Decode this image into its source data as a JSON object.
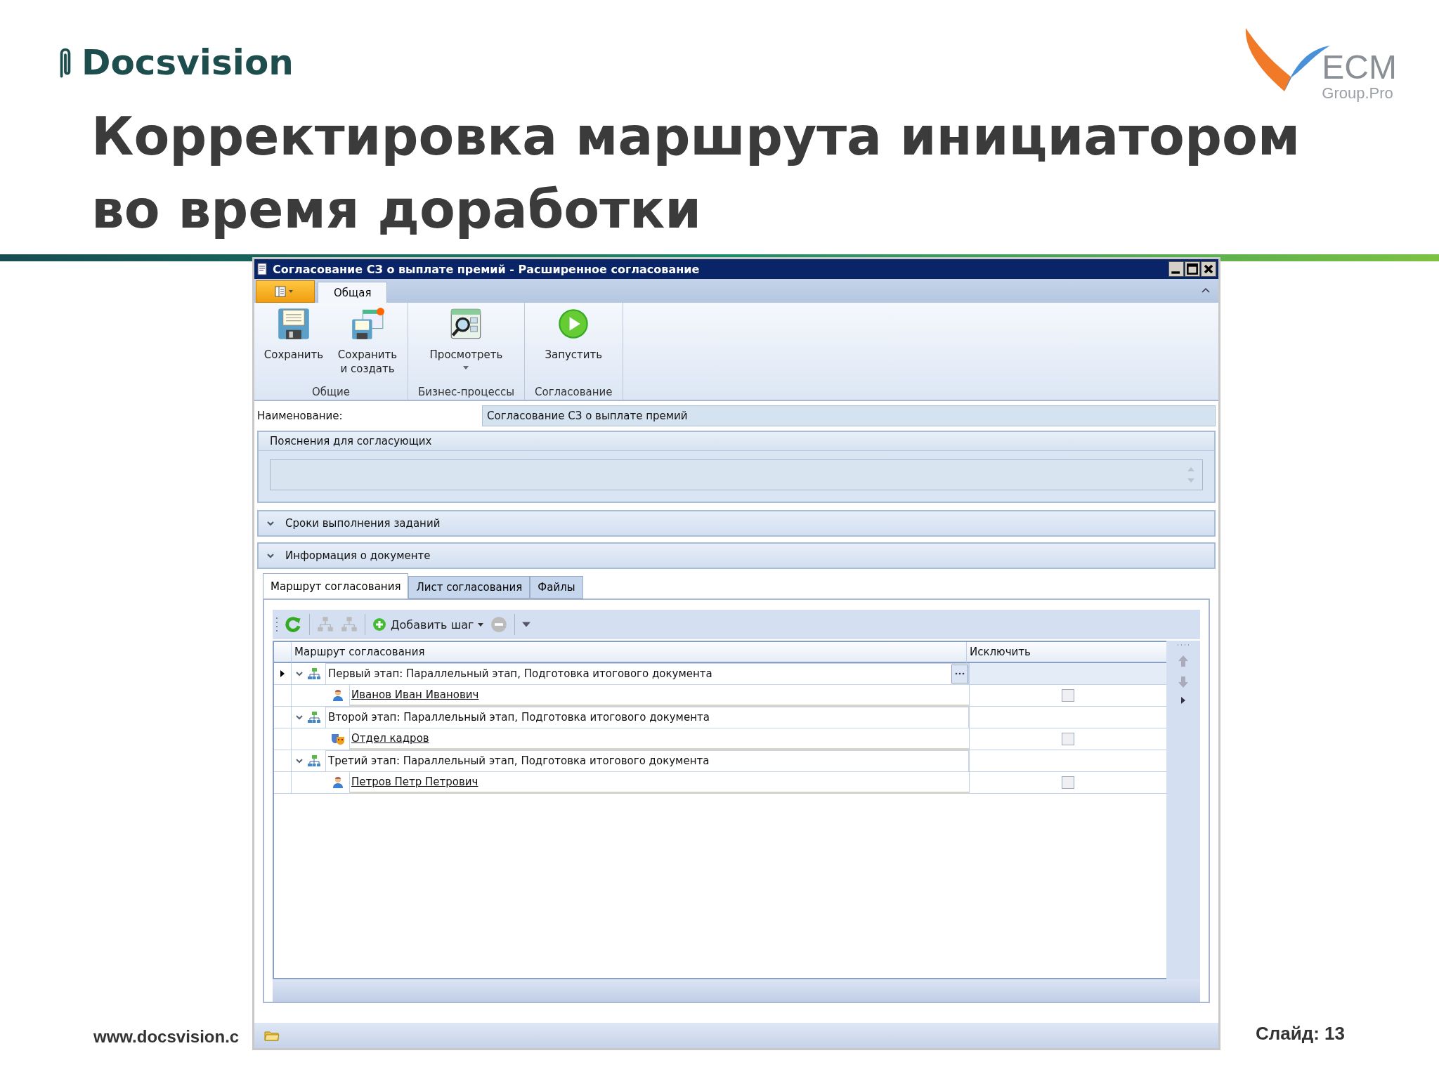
{
  "slide": {
    "brand": "Docsvision",
    "partner_logo": {
      "name": "ECM",
      "subtitle": "Group.Pro"
    },
    "title_lines": [
      "Корректировка маршрута инициатором",
      "во время доработки"
    ],
    "footer_url": "www.docsvision.c",
    "slide_number": "Слайд: 13"
  },
  "window": {
    "title": "Согласование СЗ о выплате премий - Расширенное согласование"
  },
  "ribbon": {
    "tabs": [
      {
        "label": "Общая",
        "selected": true
      }
    ],
    "groups": [
      {
        "label": "Общие",
        "buttons": [
          {
            "label": "Сохранить",
            "dropdown": false
          },
          {
            "label": "Сохранить и создать",
            "dropdown": false
          }
        ]
      },
      {
        "label": "Бизнес-процессы",
        "buttons": [
          {
            "label": "Просмотреть",
            "dropdown": true
          }
        ]
      },
      {
        "label": "Согласование",
        "buttons": [
          {
            "label": "Запустить",
            "dropdown": false
          }
        ]
      }
    ]
  },
  "form": {
    "name_label": "Наименование:",
    "name_value": "Согласование СЗ о выплате премий",
    "notes_title": "Пояснения для согласующих",
    "sections": [
      {
        "title": "Сроки выполнения заданий",
        "expanded": false
      },
      {
        "title": "Информация о документе",
        "expanded": false
      }
    ]
  },
  "tabs": [
    {
      "label": "Маршрут согласования",
      "selected": true
    },
    {
      "label": "Лист согласования",
      "selected": false
    },
    {
      "label": "Файлы",
      "selected": false
    }
  ],
  "toolbar": {
    "add_step": "Добавить шаг"
  },
  "grid": {
    "columns": [
      "Маршрут согласования",
      "Исключить"
    ],
    "rows": [
      {
        "text": "Первый этап: Параллельный этап, Подготовка итогового документа",
        "current": true,
        "expanded": true,
        "children": [
          {
            "kind": "person",
            "text": "Иванов Иван Иванович",
            "excluded": false
          }
        ]
      },
      {
        "text": "Второй этап: Параллельный этап, Подготовка итогового документа",
        "current": false,
        "expanded": true,
        "children": [
          {
            "kind": "department",
            "text": "Отдел кадров",
            "excluded": false
          }
        ]
      },
      {
        "text": "Третий этап: Параллельный этап, Подготовка итогового документа",
        "current": false,
        "expanded": true,
        "children": [
          {
            "kind": "person",
            "text": "Петров Петр Петрович",
            "excluded": false
          }
        ]
      }
    ]
  }
}
